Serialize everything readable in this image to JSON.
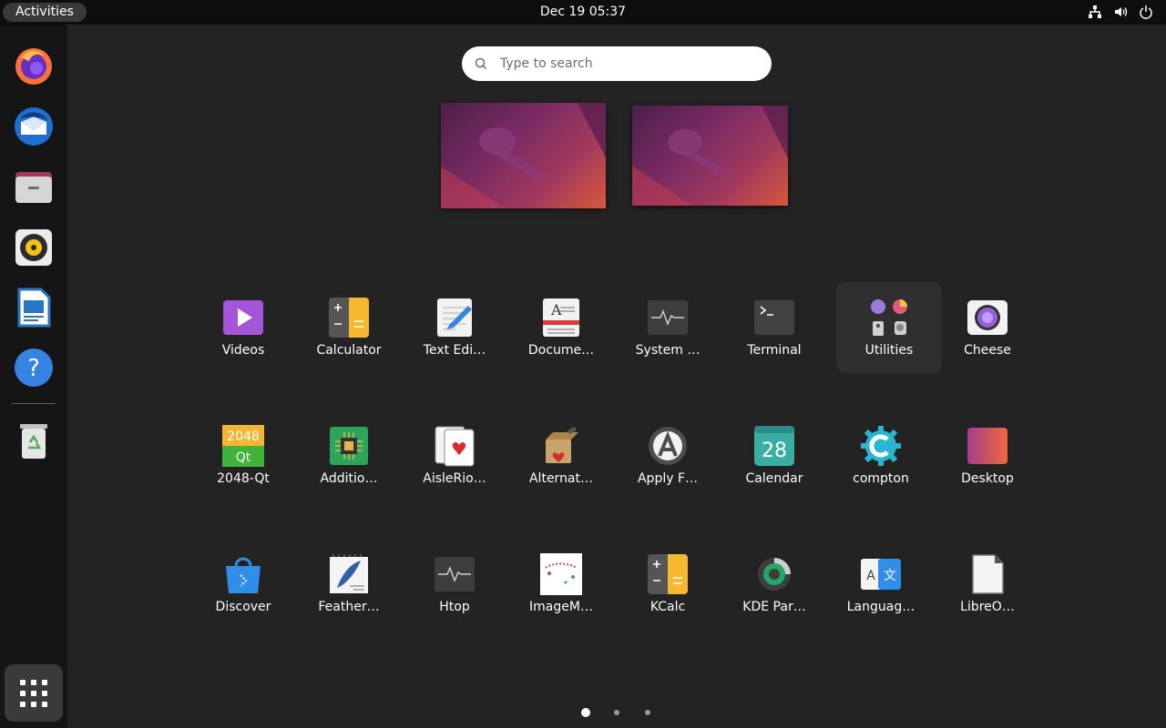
{
  "topbar": {
    "activities_label": "Activities",
    "clock": "Dec 19  05:37",
    "tray_icons": [
      "network-icon",
      "volume-icon",
      "power-icon"
    ]
  },
  "dock": {
    "items": [
      "Firefox",
      "Thunderbird",
      "Files",
      "Rhythmbox",
      "LibreOffice Writer",
      "Help",
      "Trash"
    ],
    "show_apps_icon": "app-grid-icon"
  },
  "search": {
    "placeholder": "Type to search"
  },
  "apps": [
    {
      "label": "Videos",
      "icon": "videos-icon"
    },
    {
      "label": "Calculator",
      "icon": "calculator-icon"
    },
    {
      "label": "Text Edi…",
      "icon": "text-editor-icon"
    },
    {
      "label": "Docume…",
      "icon": "document-viewer-icon"
    },
    {
      "label": "System …",
      "icon": "system-monitor-icon"
    },
    {
      "label": "Terminal",
      "icon": "terminal-icon"
    },
    {
      "label": "Utilities",
      "icon": "utilities-folder-icon"
    },
    {
      "label": "Cheese",
      "icon": "cheese-icon"
    },
    {
      "label": "2048-Qt",
      "icon": "2048-qt-icon"
    },
    {
      "label": "Additio…",
      "icon": "additional-drivers-icon"
    },
    {
      "label": "AisleRio…",
      "icon": "aisleriot-icon"
    },
    {
      "label": "Alternat…",
      "icon": "alternatives-icon"
    },
    {
      "label": "Apply F…",
      "icon": "apply-font-icon"
    },
    {
      "label": "Calendar",
      "icon": "calendar-icon"
    },
    {
      "label": "compton",
      "icon": "compton-icon"
    },
    {
      "label": "Desktop",
      "icon": "desktop-icon"
    },
    {
      "label": "Discover",
      "icon": "discover-icon"
    },
    {
      "label": "Feather…",
      "icon": "feather-icon"
    },
    {
      "label": "Htop",
      "icon": "htop-icon"
    },
    {
      "label": "ImageM…",
      "icon": "imagemagick-icon"
    },
    {
      "label": "KCalc",
      "icon": "kcalc-icon"
    },
    {
      "label": "KDE Par…",
      "icon": "kde-partition-icon"
    },
    {
      "label": "Languag…",
      "icon": "language-icon"
    },
    {
      "label": "LibreO…",
      "icon": "libreoffice-icon"
    }
  ],
  "icon_text": {
    "t2048": "2048",
    "tqt": "Qt",
    "calendar_day": "28"
  },
  "pager": {
    "pages": 3,
    "current": 1
  },
  "colors": {
    "background": "#232323",
    "dock": "#151515",
    "topbar": "#0e0e0e",
    "accent": "#e95420"
  }
}
